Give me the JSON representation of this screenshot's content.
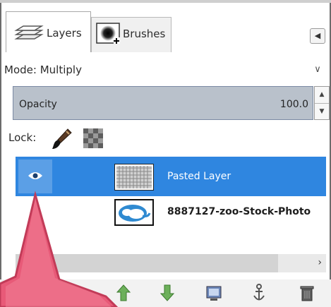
{
  "tabs": {
    "layers": {
      "label": "Layers",
      "icon": "layers-icon"
    },
    "brushes": {
      "label": "Brushes",
      "icon": "brush-icon"
    },
    "menu_icon": "tab-menu-icon"
  },
  "mode": {
    "label": "Mode:",
    "value": "Multiply"
  },
  "opacity": {
    "label": "Opacity",
    "value": "100.0"
  },
  "lock": {
    "label": "Lock:",
    "icons": [
      "lock-pixels-icon",
      "lock-alpha-icon"
    ]
  },
  "layers": [
    {
      "name": "Pasted Layer",
      "selected": true,
      "visible": true
    },
    {
      "name": "8887127-zoo-Stock-Photo",
      "selected": false,
      "visible": false
    }
  ],
  "toolbar": {
    "buttons": [
      "new-layer-icon",
      "new-layer-group-icon",
      "raise-layer-icon",
      "lower-layer-icon",
      "duplicate-layer-icon",
      "anchor-layer-icon",
      "delete-layer-icon"
    ]
  },
  "colors": {
    "selection": "#2f86e0",
    "overlay_arrow": "#e85a78",
    "opacity_fill": "#b9c1cb"
  }
}
